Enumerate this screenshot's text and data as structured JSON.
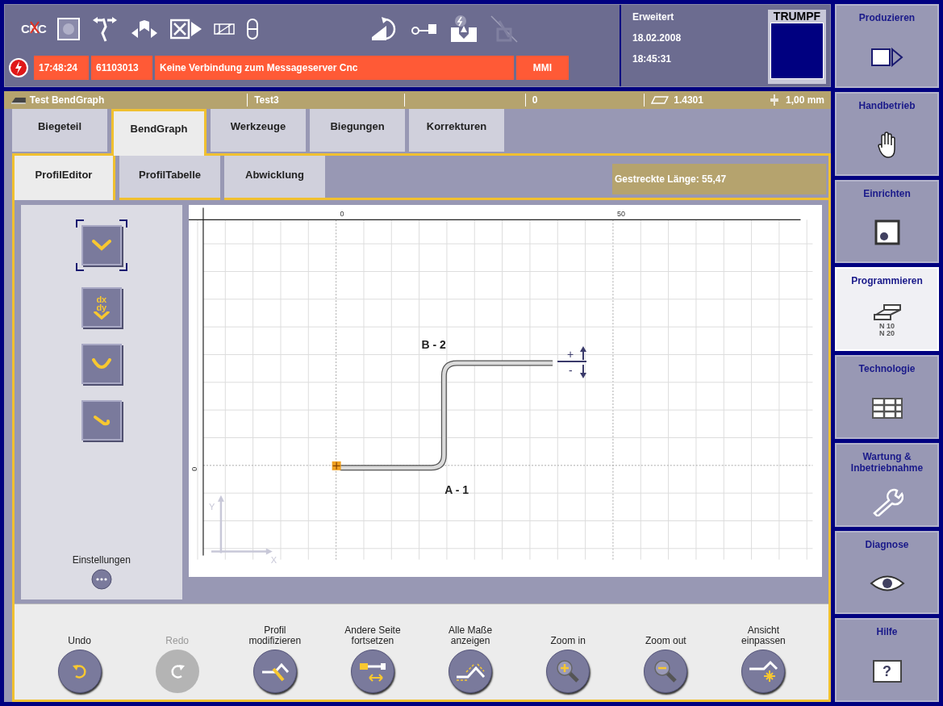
{
  "header": {
    "cnc": "CNC",
    "alarm": {
      "time": "17:48:24",
      "code": "61103013",
      "message": "Keine Verbindung zum Messageserver Cnc",
      "source": "MMI"
    },
    "status": {
      "mode": "Erweitert",
      "date": "18.02.2008",
      "time": "18:45:31"
    },
    "logo": "TRUMPF"
  },
  "info_bar": {
    "part": "Test BendGraph",
    "program": "Test3",
    "count": "0",
    "material": "1.4301",
    "thickness": "1,00 mm"
  },
  "tabs": [
    {
      "label": "Biegeteil",
      "selected": false
    },
    {
      "label": "BendGraph",
      "selected": true
    },
    {
      "label": "Werkzeuge",
      "selected": false
    },
    {
      "label": "Biegungen",
      "selected": false
    },
    {
      "label": "Korrekturen",
      "selected": false
    }
  ],
  "subtabs": [
    {
      "label": "ProfilEditor",
      "selected": true
    },
    {
      "label": "ProfilTabelle",
      "selected": false
    },
    {
      "label": "Abwicklung",
      "selected": false
    }
  ],
  "stretched_length": "Gestreckte Länge: 55,47",
  "tools": [
    {
      "kind": "bend",
      "selected": true
    },
    {
      "kind": "dxdy",
      "selected": false,
      "icon_text": [
        "dx",
        "dy"
      ]
    },
    {
      "kind": "arc",
      "selected": false
    },
    {
      "kind": "hem",
      "selected": false
    }
  ],
  "settings": {
    "label": "Einstellungen"
  },
  "canvas": {
    "x_ticks": [
      "0",
      "50"
    ],
    "y_ticks": [
      "0"
    ],
    "bends": [
      {
        "label": "B - 2"
      },
      {
        "label": "A - 1"
      }
    ],
    "direction": [
      "+",
      "-"
    ],
    "axes": [
      "Y",
      "X"
    ]
  },
  "toolbar": [
    {
      "kind": "undo",
      "label": [
        "Undo"
      ],
      "disabled": false
    },
    {
      "kind": "redo",
      "label": [
        "Redo"
      ],
      "disabled": true
    },
    {
      "kind": "modify",
      "label": [
        "Profil",
        "modifizieren"
      ],
      "disabled": false
    },
    {
      "kind": "other_side",
      "label": [
        "Andere Seite",
        "fortsetzen"
      ],
      "disabled": false
    },
    {
      "kind": "dimensions",
      "label": [
        "Alle Maße",
        "anzeigen"
      ],
      "disabled": false
    },
    {
      "kind": "zoom_in",
      "label": [
        "Zoom in"
      ],
      "disabled": false
    },
    {
      "kind": "zoom_out",
      "label": [
        "Zoom out"
      ],
      "disabled": false
    },
    {
      "kind": "fit",
      "label": [
        "Ansicht",
        "einpassen"
      ],
      "disabled": false
    }
  ],
  "sidebar": [
    {
      "kind": "produce",
      "label": "Produzieren",
      "selected": false
    },
    {
      "kind": "manual",
      "label": "Handbetrieb",
      "selected": false
    },
    {
      "kind": "setup",
      "label": "Einrichten",
      "selected": false
    },
    {
      "kind": "program",
      "label": "Programmieren",
      "selected": true,
      "icon_text": [
        "N 10",
        "N 20"
      ]
    },
    {
      "kind": "technology",
      "label": "Technologie",
      "selected": false
    },
    {
      "kind": "service",
      "label": "Wartung & Inbetriebnahme",
      "selected": false
    },
    {
      "kind": "diagnosis",
      "label": "Diagnose",
      "selected": false
    },
    {
      "kind": "help",
      "label": "Hilfe",
      "selected": false,
      "icon_text": [
        "?"
      ]
    }
  ]
}
